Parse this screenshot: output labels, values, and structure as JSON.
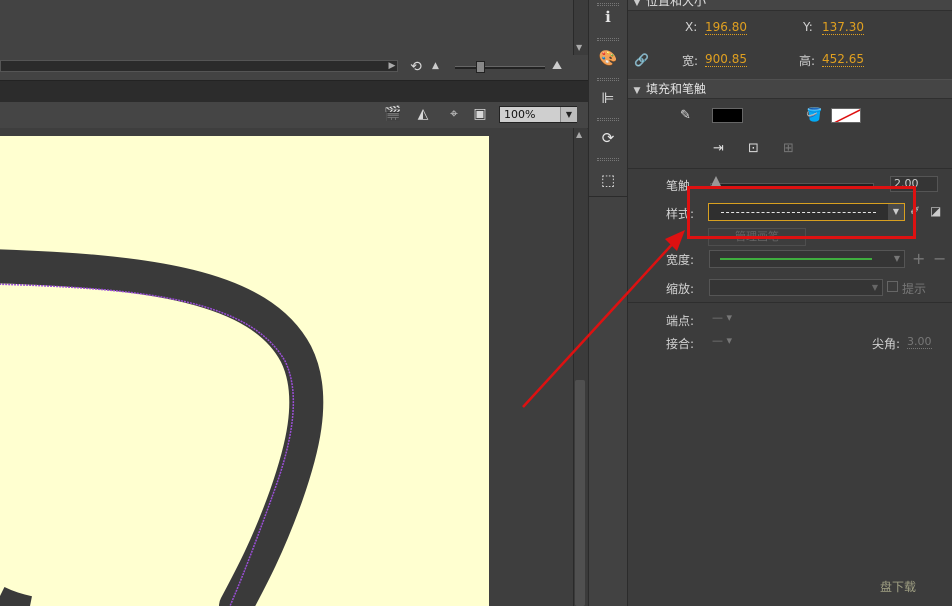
{
  "sections": {
    "position_size": "位置和大小",
    "fill_stroke": "填充和笔触"
  },
  "position": {
    "x_label": "X:",
    "x_value": "196.80",
    "y_label": "Y:",
    "y_value": "137.30",
    "w_label": "宽:",
    "w_value": "900.85",
    "h_label": "高:",
    "h_value": "452.65"
  },
  "stroke": {
    "stroke_label": "笔触",
    "stroke_value": "2.00",
    "style_label": "样式:",
    "manage_button": "管理画笔",
    "width_label": "宽度:",
    "scale_label": "缩放:",
    "hint_label": "提示",
    "cap_label": "端点:",
    "join_label": "接合:",
    "miter_label": "尖角:",
    "miter_value": "3.00"
  },
  "toolbar": {
    "zoom": "100%"
  },
  "colors": {
    "stroke_color": "#000000",
    "artboard": "#ffffd0",
    "accent_value": "#e0a020",
    "callout": "#dd1111",
    "path_outline": "#3a3a3a",
    "path_center": "#9b4fd8"
  },
  "watermark": "盘下载"
}
